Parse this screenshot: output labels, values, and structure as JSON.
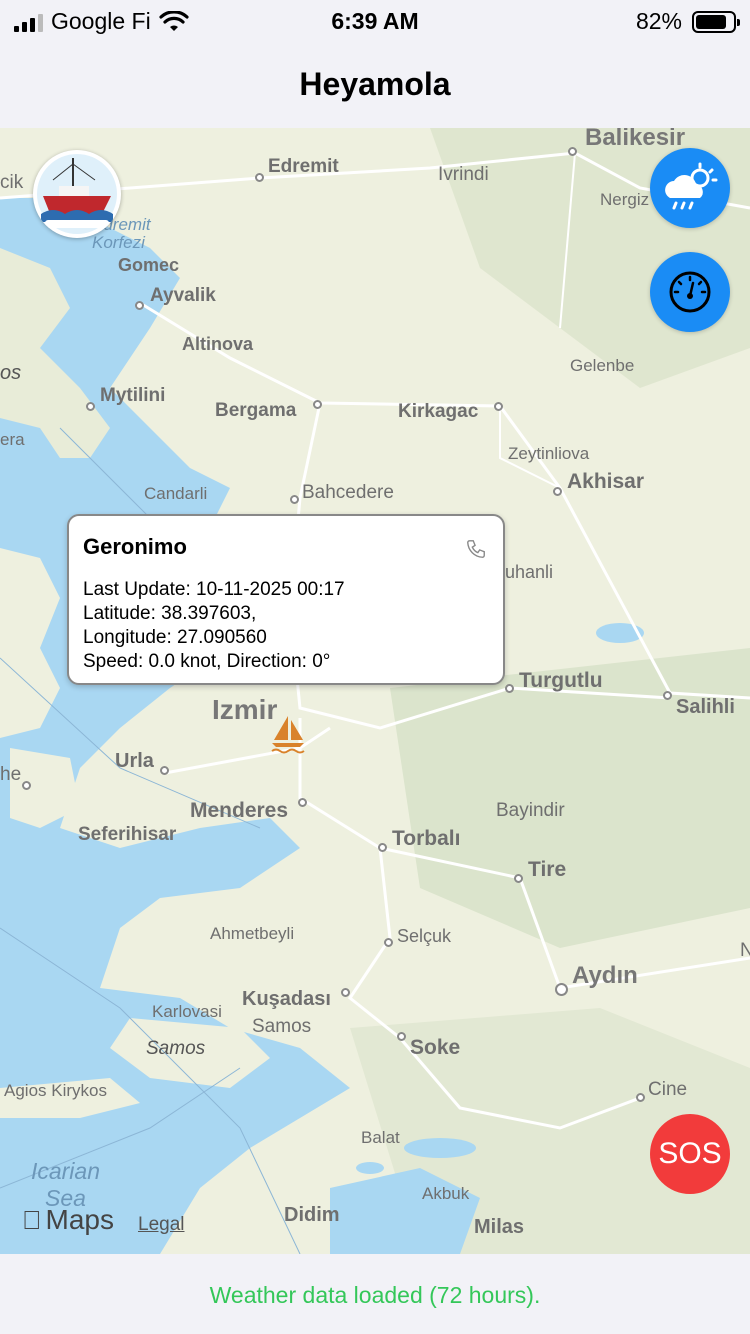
{
  "status_bar": {
    "carrier": "Google Fi",
    "time": "6:39 AM",
    "battery_percent_label": "82%",
    "battery_level": 0.82
  },
  "nav": {
    "title": "Heyamola"
  },
  "map": {
    "places": [
      {
        "label": "Balikesir",
        "kind": "big"
      },
      {
        "label": "Edremit",
        "kind": "town"
      },
      {
        "label": "Ivrindi",
        "kind": "town"
      },
      {
        "label": "Nergiz",
        "kind": "town"
      },
      {
        "label": "cik",
        "kind": "town"
      },
      {
        "label": "Edremit Korfezi",
        "kind": "sea"
      },
      {
        "label": "Gomec",
        "kind": "town"
      },
      {
        "label": "Ayvalik",
        "kind": "town"
      },
      {
        "label": "Altinova",
        "kind": "town"
      },
      {
        "label": "Gelenbe",
        "kind": "town"
      },
      {
        "label": "os",
        "kind": "island"
      },
      {
        "label": "Mytilini",
        "kind": "town"
      },
      {
        "label": "Bergama",
        "kind": "town"
      },
      {
        "label": "Kirkagac",
        "kind": "town"
      },
      {
        "label": "era",
        "kind": "town"
      },
      {
        "label": "Zeytinliova",
        "kind": "town"
      },
      {
        "label": "Akhisar",
        "kind": "town"
      },
      {
        "label": "Candarli",
        "kind": "town"
      },
      {
        "label": "Bahcedere",
        "kind": "town"
      },
      {
        "label": "uhanli",
        "kind": "town"
      },
      {
        "label": "Turgutlu",
        "kind": "town"
      },
      {
        "label": "Salihli",
        "kind": "town"
      },
      {
        "label": "Izmir",
        "kind": "big"
      },
      {
        "label": "Urla",
        "kind": "town"
      },
      {
        "label": "he",
        "kind": "town"
      },
      {
        "label": "Menderes",
        "kind": "town"
      },
      {
        "label": "Bayindir",
        "kind": "town"
      },
      {
        "label": "Seferihisar",
        "kind": "town"
      },
      {
        "label": "Torbalı",
        "kind": "town"
      },
      {
        "label": "Tire",
        "kind": "town"
      },
      {
        "label": "Ahmetbeyli",
        "kind": "town"
      },
      {
        "label": "Selçuk",
        "kind": "town"
      },
      {
        "label": "Aydın",
        "kind": "big"
      },
      {
        "label": "Kuşadası",
        "kind": "town"
      },
      {
        "label": "Karlovasi",
        "kind": "town"
      },
      {
        "label": "Samos",
        "kind": "town"
      },
      {
        "label": "Samos",
        "kind": "island"
      },
      {
        "label": "Soke",
        "kind": "town"
      },
      {
        "label": "Agios Kirykos",
        "kind": "town"
      },
      {
        "label": "Cine",
        "kind": "town"
      },
      {
        "label": "Balat",
        "kind": "town"
      },
      {
        "label": "Icarian Sea",
        "kind": "sea"
      },
      {
        "label": "Akbuk",
        "kind": "town"
      },
      {
        "label": "Didim",
        "kind": "town"
      },
      {
        "label": "Milas",
        "kind": "town"
      },
      {
        "label": "N",
        "kind": "town"
      }
    ],
    "attribution": "Maps",
    "legal": "Legal"
  },
  "vessel_popup": {
    "name": "Geronimo",
    "last_update": "Last Update: 10-11-2025 00:17",
    "latitude": "Latitude: 38.397603,",
    "longitude": "Longitude: 27.090560",
    "speed_direction": "Speed: 0.0 knot, Direction: 0°"
  },
  "buttons": {
    "sos_label": "SOS"
  },
  "footer": {
    "message": "Weather data loaded (72 hours)."
  },
  "colors": {
    "accent_blue": "#1a8cf5",
    "sos_red": "#f23b3b",
    "status_green": "#34c759",
    "boat_orange": "#d9822b",
    "sea_blue": "#a9d7f2",
    "land": "#eef0df"
  },
  "icons": {
    "weather_button": "cloud-sun-rain-icon",
    "gauge_button": "speedometer-icon",
    "phone": "phone-icon",
    "vessel": "sailboat-icon",
    "logo": "heyamola-logo"
  }
}
